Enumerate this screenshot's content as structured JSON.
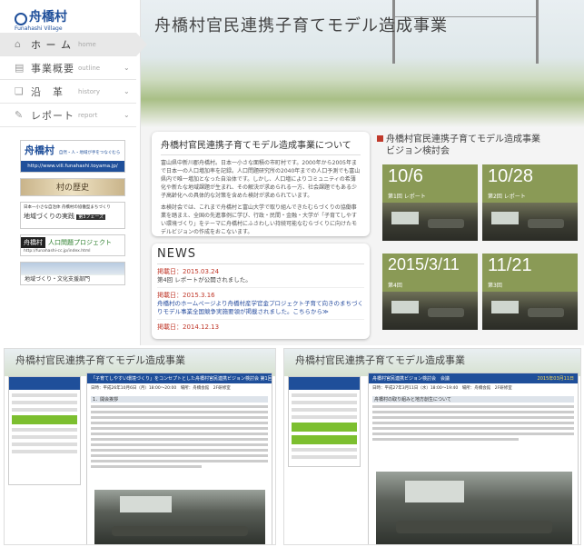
{
  "site": {
    "title": "舟橋村官民連携子育てモデル造成事業",
    "logo_jp": "舟橋村",
    "logo_en": "Funahashi Village"
  },
  "nav": [
    {
      "jp": "ホ ー ム",
      "en": "home",
      "icon": "home-icon"
    },
    {
      "jp": "事業概要",
      "en": "outline",
      "icon": "document-icon"
    },
    {
      "jp": "沿　革",
      "en": "history",
      "icon": "book-icon"
    },
    {
      "jp": "レポート",
      "en": "report",
      "icon": "pencil-icon"
    }
  ],
  "banners": [
    {
      "jp": "舟橋村",
      "sub": "自然・人・地域が手をつなぐむら",
      "url": "http://www.vill.funahashi.toyama.jp/"
    },
    {
      "jp": "村の歴史"
    },
    {
      "line1": "日本一小さな自治体 舟橋村の協働型まちづくり",
      "line2": "地域づくりの実践",
      "badge": "第3フェーズ"
    },
    {
      "jp": "舟橋村",
      "title": "人口問題プロジェクト",
      "url": "http://funahashi-cc.jp/index.html"
    },
    {
      "title": "地域づくり・文化支援部門"
    }
  ],
  "about": {
    "heading": "舟橋村官民連携子育てモデル造成事業について",
    "p1": "富山県中新川郡舟橋村。日本一小さな面積の市町村です。2000年から2005年まで日本一の人口増加率を記録。人口問題研究所の2040年までの人口予測でも富山県内で唯一増加となった自治体です。しかし、人口増によりコミュニティの希薄化や新たな地域課題が生まれ、その解決が求められる一方、社会課題でもある少子高齢化への具体的な対策を含めた検討が求められています。",
    "p2": "本検討会では、これまで舟橋村と富山大学で取り組んできたむらづくりの協働事業を踏まえ、全国の先進事例に学び、行政・民間・金融・大学が「子育てしやすい環境づくり」をテーマに舟橋村にふさわしい持続可能なむらづくりに向けたモデルビジョンの作成をおこないます。"
  },
  "news": {
    "heading": "NEWS",
    "items": [
      {
        "date": "掲載日：2015.03.24",
        "text": "第4回 レポートが公開されました。",
        "link": false
      },
      {
        "date": "掲載日：2015.3.16",
        "text": "舟橋村のホームページより舟橋村産学官金プロジェクト子育て向きのまちづくりモデル事業全国競争実施要領が掲載されました。こちらから≫",
        "link": true
      },
      {
        "date": "掲載日：2014.12.13",
        "text": "",
        "link": false
      }
    ]
  },
  "vision": {
    "title_line1": "舟橋村官民連携子育てモデル造成事業",
    "title_line2": "ビジョン検討会",
    "reports": [
      {
        "date": "10/6",
        "label": "第1回 レポート"
      },
      {
        "date": "10/28",
        "label": "第2回 レポート"
      },
      {
        "date": "2015/3/11",
        "label": "第4回"
      },
      {
        "date": "11/21",
        "label": "第3回"
      }
    ]
  },
  "report_pages": [
    {
      "header": "舟橋村官民連携子育てモデル造成事業",
      "doc_title": "「子育てしやすい環境づくり」をコンセプトとした舟橋村官民連携ビジョン検討会 第1回",
      "meta": "日時：平成26年10月6日（月）18:00〜20:00　場所：舟橋会館　2F研修室",
      "section": "1．開会挨拶"
    },
    {
      "header": "舟橋村官民連携子育てモデル造成事業",
      "doc_title": "舟橋村官民連携ビジョン検討会　会議",
      "date": "2015年03月11日",
      "meta": "日時：平成27年3月11日（水）18:00〜19:40　場所：舟橋会館　2F研修室",
      "section": "舟橋村の取り組みと地方創生について"
    }
  ],
  "colors": {
    "brand": "#1f4f9a",
    "accent_red": "#c0392b",
    "tile_green": "#8a9a56",
    "sub_green": "#7cbf2f"
  }
}
